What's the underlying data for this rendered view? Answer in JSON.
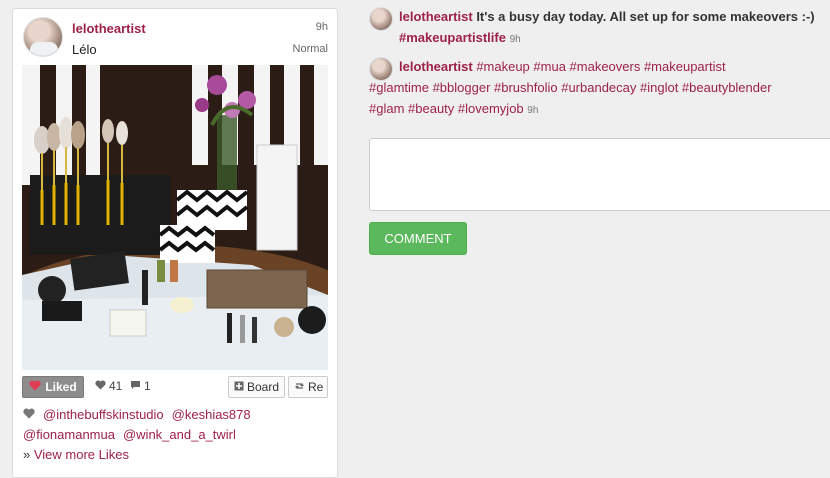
{
  "post": {
    "username": "lelotheartist",
    "time": "9h",
    "display_name": "Lélo",
    "filter": "Normal",
    "photo_icon": "makeup-photo",
    "actions": {
      "liked_label": "Liked",
      "likes_count": "41",
      "comments_count": "1",
      "board_label": "Board",
      "repost_label": "Re"
    },
    "likers": [
      "@inthebuffskinstudio",
      "@keshias878",
      "@fionamanmua",
      "@wink_and_a_twirl"
    ],
    "view_more_prefix": "»",
    "view_more_label": "View more Likes"
  },
  "comments": [
    {
      "user": "lelotheartist",
      "text": "It's a busy day today. All set up for some makeovers :-)",
      "hashtag": "#makeupartistlife",
      "time": "9h"
    },
    {
      "user": "lelotheartist",
      "tags_line1": "#makeup #mua #makeovers #makeupartist",
      "tags_line2": "#glamtime #bblogger #brushfolio #urbandecay #inglot #beautyblender",
      "tags_line3": "#glam #beauty #lovemyjob",
      "time": "9h"
    }
  ],
  "comment_box": {
    "placeholder": ""
  },
  "comment_button": "COMMENT",
  "colors": {
    "brand": "#9e2148",
    "button_green": "#5cb85c",
    "liked_gray": "#8d8d8d"
  }
}
